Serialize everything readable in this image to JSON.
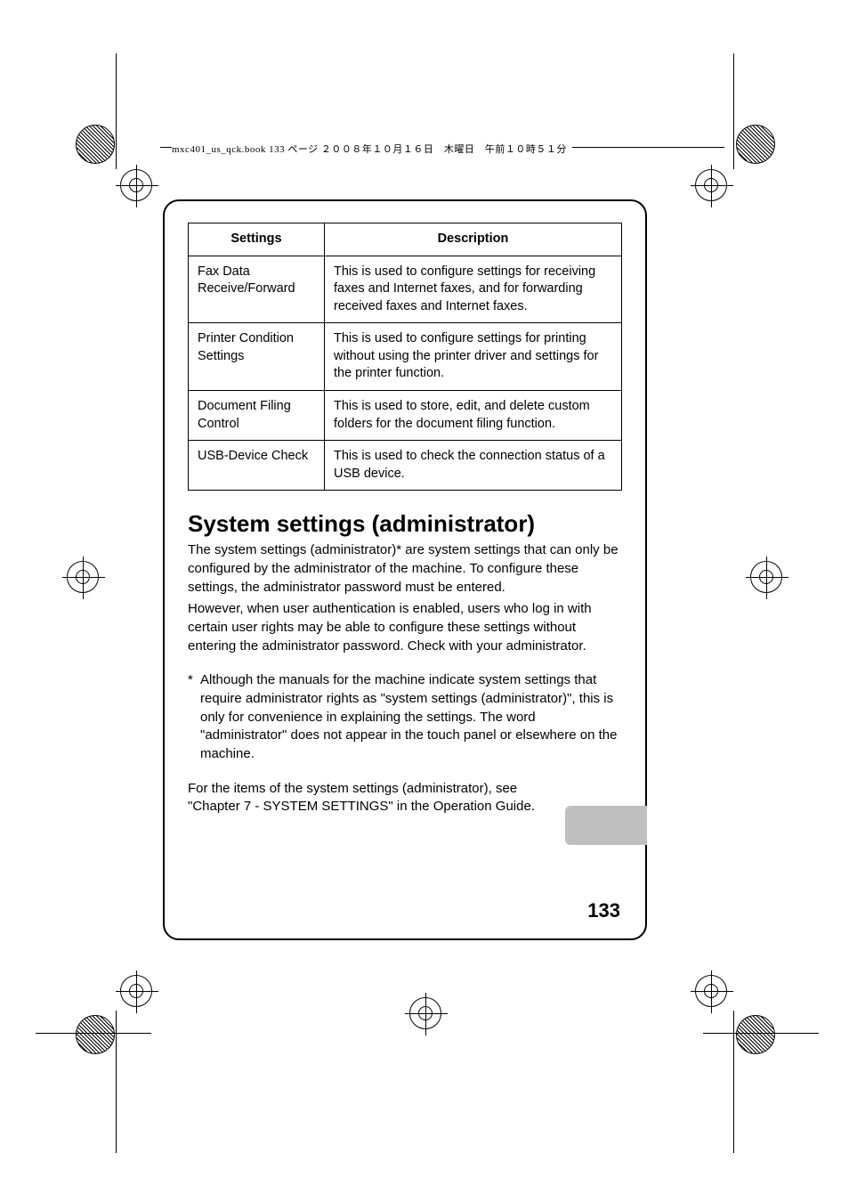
{
  "header_line": "mxc401_us_qck.book  133 ページ  ２００８年１０月１６日　木曜日　午前１０時５１分",
  "table": {
    "head": {
      "c1": "Settings",
      "c2": "Description"
    },
    "rows": [
      {
        "c1": "Fax Data Receive/Forward",
        "c2": "This is used to configure settings for receiving faxes and Internet faxes, and for forwarding received faxes and Internet faxes."
      },
      {
        "c1": "Printer Condition Settings",
        "c2": "This is used to configure settings for printing without using the printer driver and settings for the printer function."
      },
      {
        "c1": "Document Filing Control",
        "c2": "This is used to store, edit, and delete custom folders for the document filing function."
      },
      {
        "c1": "USB-Device Check",
        "c2": "This is used to check the connection status of a USB device."
      }
    ]
  },
  "section_title": "System settings (administrator)",
  "para1": "The system settings (administrator)* are system settings that can only be configured by the administrator of the machine. To configure these settings, the administrator password must be entered.",
  "para2": "However, when user authentication is enabled, users who log in with certain user rights may be able to configure these settings without entering the administrator password. Check with your administrator.",
  "footnote_mark": "*",
  "footnote_text": "Although the manuals for the machine indicate system settings that require administrator rights as \"system settings (administrator)\", this is only for convenience in explaining the settings. The word \"administrator\" does not appear in the touch panel or elsewhere on the machine.",
  "ref1": "For the items of the system settings (administrator), see",
  "ref2": "\"Chapter 7 - SYSTEM SETTINGS\" in the Operation Guide.",
  "page_number": "133"
}
